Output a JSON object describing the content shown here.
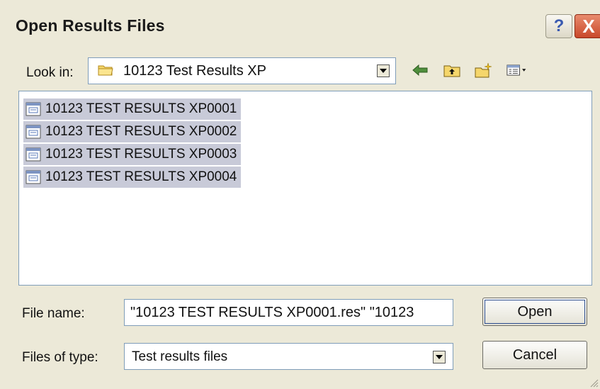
{
  "window": {
    "title": "Open Results Files",
    "help_label": "?",
    "close_label": "X"
  },
  "lookin": {
    "label": "Look in:",
    "value": "10123 Test Results XP",
    "icon": "folder-icon"
  },
  "toolbar": {
    "icons": [
      "back-arrow-icon",
      "up-folder-icon",
      "new-folder-icon",
      "view-menu-icon"
    ]
  },
  "files": [
    {
      "name": "10123 TEST RESULTS XP0001",
      "icon": "results-file-icon",
      "selected": true
    },
    {
      "name": "10123 TEST RESULTS XP0002",
      "icon": "results-file-icon",
      "selected": true
    },
    {
      "name": "10123 TEST RESULTS XP0003",
      "icon": "results-file-icon",
      "selected": true
    },
    {
      "name": "10123 TEST RESULTS XP0004",
      "icon": "results-file-icon",
      "selected": true
    }
  ],
  "filename": {
    "label": "File name:",
    "value": "\"10123 TEST RESULTS XP0001.res\" \"10123"
  },
  "filetype": {
    "label": "Files of type:",
    "value": "Test results files"
  },
  "buttons": {
    "open_label": "Open",
    "cancel_label": "Cancel"
  },
  "colors": {
    "dialog_bg": "#ece9d8",
    "selection": "#c8cad8",
    "close_button": "#c9482a",
    "field_border": "#7f9db9"
  }
}
